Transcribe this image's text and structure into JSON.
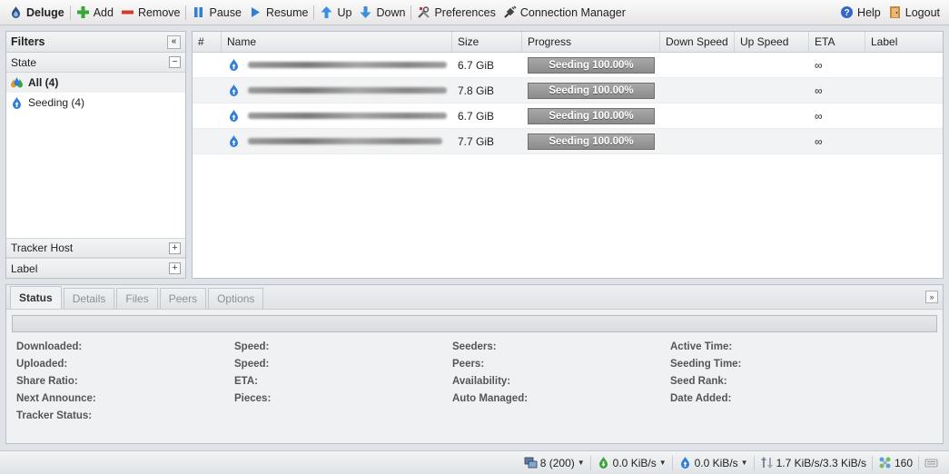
{
  "toolbar": {
    "brand": "Deluge",
    "add": "Add",
    "remove": "Remove",
    "pause": "Pause",
    "resume": "Resume",
    "up": "Up",
    "down": "Down",
    "preferences": "Preferences",
    "connection_manager": "Connection Manager",
    "help": "Help",
    "logout": "Logout"
  },
  "filters": {
    "title": "Filters",
    "state_header": "State",
    "state_items": [
      {
        "label": "All (4)",
        "icon": "all-states-icon"
      },
      {
        "label": "Seeding (4)",
        "icon": "seeding-icon"
      }
    ],
    "tracker_host": "Tracker Host",
    "label": "Label"
  },
  "grid": {
    "columns": [
      "#",
      "Name",
      "Size",
      "Progress",
      "Down Speed",
      "Up Speed",
      "ETA",
      "Label"
    ],
    "rows": [
      {
        "size": "6.7 GiB",
        "progress": "Seeding 100.00%",
        "eta": "∞"
      },
      {
        "size": "7.8 GiB",
        "progress": "Seeding 100.00%",
        "eta": "∞"
      },
      {
        "size": "6.7 GiB",
        "progress": "Seeding 100.00%",
        "eta": "∞"
      },
      {
        "size": "7.7 GiB",
        "progress": "Seeding 100.00%",
        "eta": "∞"
      }
    ]
  },
  "details": {
    "tabs": [
      "Status",
      "Details",
      "Files",
      "Peers",
      "Options"
    ],
    "col1": [
      "Downloaded:",
      "Uploaded:",
      "Share Ratio:",
      "Next Announce:",
      "Tracker Status:"
    ],
    "col2": [
      "Speed:",
      "Speed:",
      "ETA:",
      "Pieces:"
    ],
    "col3": [
      "Seeders:",
      "Peers:",
      "Availability:",
      "Auto Managed:"
    ],
    "col4": [
      "Active Time:",
      "Seeding Time:",
      "Seed Rank:",
      "Date Added:"
    ]
  },
  "statusbar": {
    "connections": "8 (200)",
    "download_speed": "0.0 KiB/s",
    "upload_speed": "0.0 KiB/s",
    "protocol_traffic": "1.7 KiB/s/3.3 KiB/s",
    "dht_nodes": "160"
  },
  "colors": {
    "accent_blue": "#2f7fd8",
    "add_green": "#3aa53a",
    "remove_red": "#d23a2a",
    "progress_gray": "#8b8b8b"
  }
}
